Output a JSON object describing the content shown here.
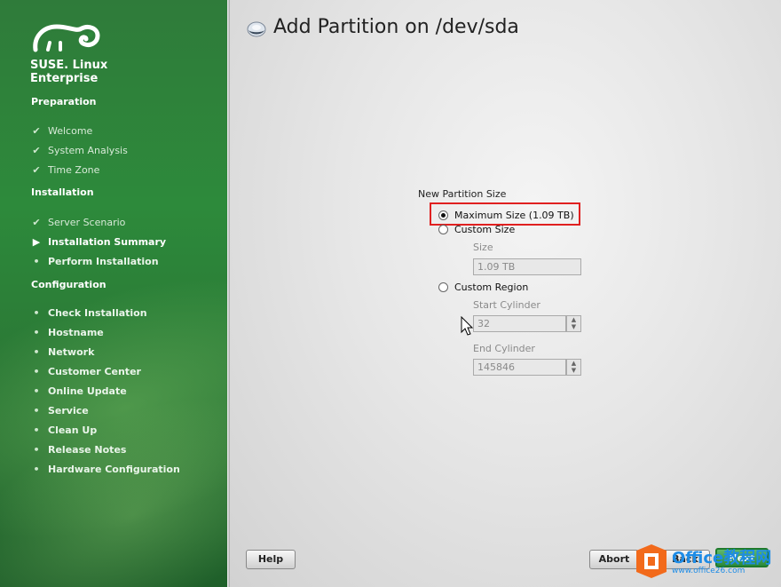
{
  "sidebar": {
    "brand_line1": "SUSE. Linux",
    "brand_line2": "Enterprise",
    "sections": [
      {
        "title": "Preparation",
        "steps": [
          "Welcome",
          "System Analysis",
          "Time Zone"
        ]
      },
      {
        "title": "Installation",
        "steps": [
          "Server Scenario",
          "Installation Summary",
          "Perform Installation"
        ]
      },
      {
        "title": "Configuration",
        "steps": [
          "Check Installation",
          "Hostname",
          "Network",
          "Customer Center",
          "Online Update",
          "Service",
          "Clean Up",
          "Release Notes",
          "Hardware Configuration"
        ]
      }
    ]
  },
  "main": {
    "title": "Add Partition on /dev/sda",
    "group_label": "New Partition Size",
    "options": {
      "max": "Maximum Size (1.09 TB)",
      "custom": "Custom Size",
      "region": "Custom Region"
    },
    "size_label": "Size",
    "size_value": "1.09 TB",
    "start_label": "Start Cylinder",
    "start_value": "32",
    "end_label": "End Cylinder",
    "end_value": "145846"
  },
  "buttons": {
    "help": "Help",
    "abort": "Abort",
    "back": "Back",
    "next": "Next"
  },
  "watermark": {
    "text": "Office教程网",
    "url": "www.office26.com"
  },
  "colors": {
    "sidebar_green": "#2d8a3b",
    "highlight_red": "#e02020",
    "watermark_blue": "#1e8ce6",
    "watermark_orange": "#f26a1b"
  }
}
